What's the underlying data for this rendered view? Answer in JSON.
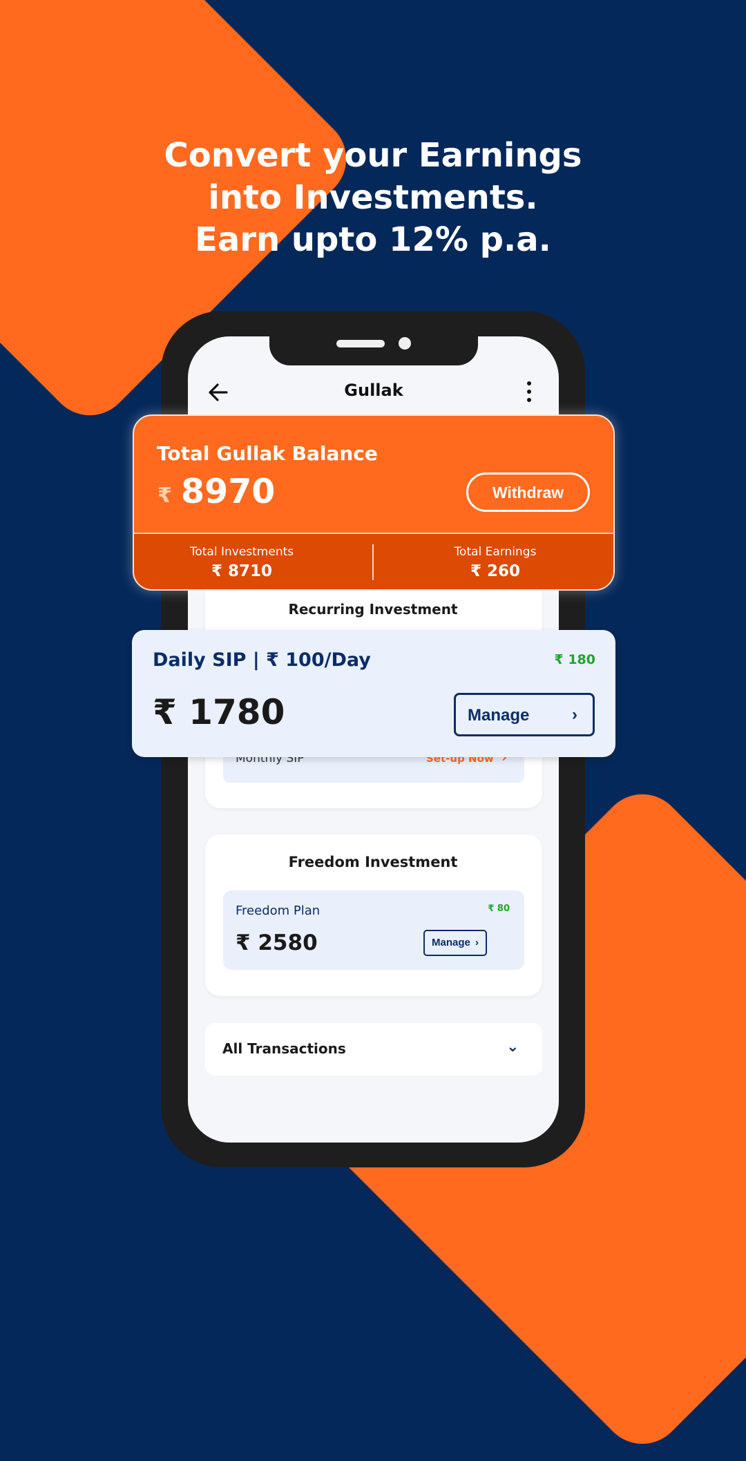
{
  "headline": {
    "line1": "Convert your Earnings",
    "line2": "into Investments.",
    "line3": "Earn upto 12% p.a."
  },
  "appbar": {
    "title": "Gullak",
    "back_icon": "arrow-left-icon",
    "menu_icon": "more-vertical-icon"
  },
  "balance": {
    "title": "Total Gullak Balance",
    "currency": "₹",
    "amount": "8970",
    "withdraw_label": "Withdraw",
    "investments_label": "Total Investments",
    "investments_value": "₹ 8710",
    "earnings_label": "Total Earnings",
    "earnings_value": "₹ 260"
  },
  "recurring": {
    "title": "Recurring Investment",
    "daily_sip": {
      "title": "Daily SIP | ₹ 100/Day",
      "earnings": "₹ 180",
      "amount": "₹ 1780",
      "manage_label": "Manage"
    },
    "monthly_sip": {
      "label": "Monthly SIP",
      "action": "Set-up Now"
    }
  },
  "freedom": {
    "title": "Freedom Investment",
    "plan_name": "Freedom Plan",
    "earnings": "₹ 80",
    "amount": "₹ 2580",
    "manage_label": "Manage"
  },
  "transactions": {
    "label": "All Transactions"
  },
  "colors": {
    "brand_orange": "#ff6a1f",
    "navy": "#05285a",
    "green": "#1fa52c"
  }
}
